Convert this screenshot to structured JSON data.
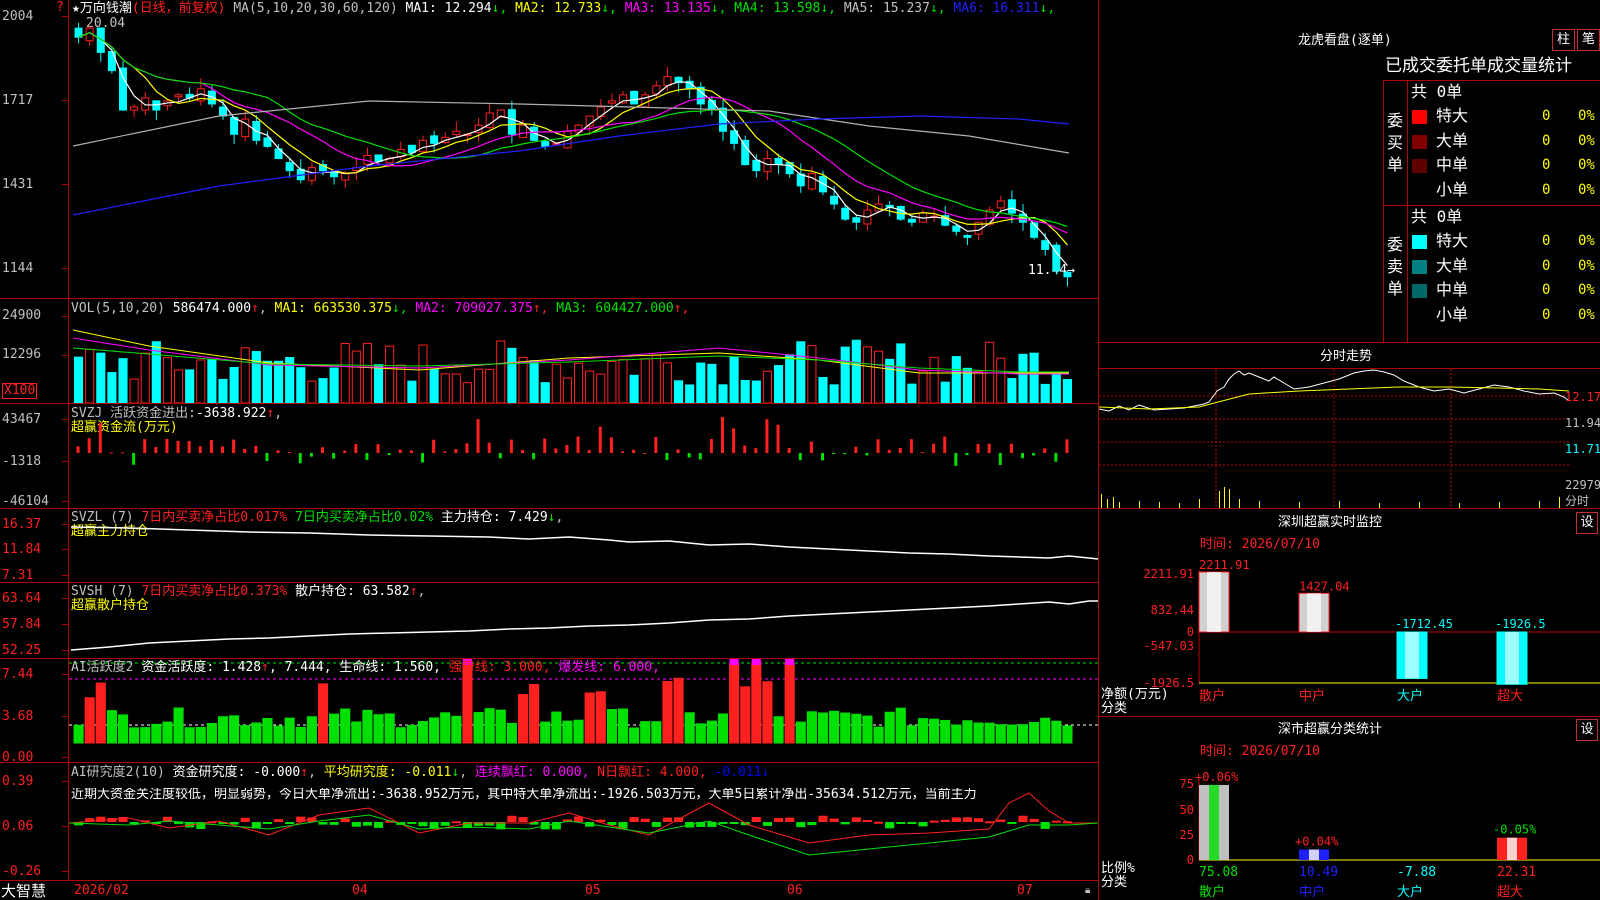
{
  "colors": {
    "up": "#ff2020",
    "down": "#00ffff",
    "red_line": "#c00000",
    "white": "#ffffff",
    "yellow": "#ffff00",
    "magenta": "#ff00ff",
    "green": "#00e000",
    "blue": "#2020ff",
    "grey": "#b0b0b0",
    "gray_text": "#c0c0c0"
  },
  "price_panel": {
    "title": "万向钱潮",
    "mode": "(日线，前复权)",
    "ma_prefix": "MA(5,10,20,30,60,120)",
    "ma": [
      {
        "label": "MA1:",
        "value": "12.294",
        "arrow": "↓",
        "color": "#ffffff"
      },
      {
        "label": "MA2:",
        "value": "12.733",
        "arrow": "↓",
        "color": "#ffff00"
      },
      {
        "label": "MA3:",
        "value": "13.135",
        "arrow": "↓",
        "color": "#ff00ff"
      },
      {
        "label": "MA4:",
        "value": "13.598",
        "arrow": "↓",
        "color": "#00e000"
      },
      {
        "label": "MA5:",
        "value": "15.237",
        "arrow": "↓",
        "color": "#c0c0c0"
      },
      {
        "label": "MA6:",
        "value": "16.311",
        "arrow": "↓",
        "color": "#2020ff"
      }
    ],
    "y_ticks": [
      "2004",
      "1717",
      "1431",
      "1144"
    ],
    "high_marker": "20.04",
    "low_marker": "11.44→",
    "question": "?"
  },
  "vol_panel": {
    "title": "VOL(5,10,20)",
    "value": "586474.000",
    "arrow": "↑",
    "ma": [
      {
        "label": "MA1:",
        "value": "663530.375",
        "arrow": "↓",
        "color": "#ffff00"
      },
      {
        "label": "MA2:",
        "value": "709027.375",
        "arrow": "↑",
        "color": "#ff00ff"
      },
      {
        "label": "MA3:",
        "value": "604427.000",
        "arrow": "↑",
        "color": "#00e000"
      }
    ],
    "y_ticks": [
      "24900",
      "12296"
    ],
    "unit": "X100"
  },
  "svzj_panel": {
    "title": "SVZJ",
    "desc": "活跃资金进出:",
    "value": "-3638.922",
    "arrow": "↑",
    "suffix": ",",
    "line2": "超赢资金流(万元)",
    "y_ticks": [
      "43467",
      "-1318",
      "-46104"
    ]
  },
  "svzl_panel": {
    "title": "SVZL (7)",
    "p1": "7日内买卖净占比0.017%",
    "p2": "7日内买卖净占比0.02%",
    "p3": "主力持仓: 7.429",
    "arrow": "↓",
    "suffix": ",",
    "line2": "超赢主力持仓",
    "y_ticks": [
      "16.37",
      "11.84",
      "7.31"
    ]
  },
  "svsh_panel": {
    "title": "SVSH (7)",
    "p1": "7日内买卖净占比0.373%",
    "p3": "散户持仓: 63.582",
    "arrow": "↑",
    "suffix": ",",
    "line2": "超赢散户持仓",
    "y_ticks": [
      "63.64",
      "57.84",
      "52.25"
    ]
  },
  "ai1_panel": {
    "title": "AI活跃度2",
    "t1": "资金活跃度: 1.428",
    "a1": "↑",
    "t2": ", 7.444,",
    "t3": "生命线: 1.560,",
    "t4": "强势线: 3.000,",
    "t5": "爆发线: 6.000,",
    "y_ticks": [
      "7.44",
      "3.68",
      "0.00"
    ]
  },
  "ai2_panel": {
    "title": "AI研究度2(10)",
    "t1": "资金研究度: -0.000",
    "a1": "↑",
    "t2": "平均研究度: -0.011",
    "a2": "↓",
    "t3": "连续飘红: 0.000,",
    "t4": "N日飘红: 4.000,",
    "t5": "-0.011",
    "a5": "↓",
    "y_ticks": [
      "0.39",
      "0.06",
      "-0.26"
    ],
    "commentary": "近期大资金关注度较低，明显弱势，今日大单净流出:-3638.952万元，其中特大单净流出:-1926.503万元，大单5日累计净出-35634.512万元，当前主力"
  },
  "x_axis": {
    "logo": "大智慧",
    "labels": [
      "2026/02",
      "04",
      "05",
      "06",
      "07"
    ]
  },
  "right": {
    "lhb_title": "龙虎看盘(逐单)",
    "btn_bar": "柱",
    "btn_pen": "笔",
    "tabs": [
      "已成交",
      "委托单",
      "成交量",
      "统计"
    ],
    "buy": {
      "side": [
        "委",
        "买",
        "单"
      ],
      "count": "共 0单",
      "rows": [
        {
          "name": "特大",
          "color": "#ff0000",
          "count": "0",
          "pct": "0%"
        },
        {
          "name": "大单",
          "color": "#800000",
          "count": "0",
          "pct": "0%"
        },
        {
          "name": "中单",
          "color": "#600000",
          "count": "0",
          "pct": "0%"
        },
        {
          "name": "小单",
          "color": "",
          "count": "0",
          "pct": "0%"
        }
      ]
    },
    "sell": {
      "side": [
        "委",
        "卖",
        "单"
      ],
      "count": "共 0单",
      "rows": [
        {
          "name": "特大",
          "color": "#00ffff",
          "count": "0",
          "pct": "0%"
        },
        {
          "name": "大单",
          "color": "#008080",
          "count": "0",
          "pct": "0%"
        },
        {
          "name": "中单",
          "color": "#006868",
          "count": "0",
          "pct": "0%"
        },
        {
          "name": "小单",
          "color": "",
          "count": "0",
          "pct": "0%"
        }
      ]
    },
    "intraday_title": "分时走势",
    "intraday_ticks": [
      "12.17",
      "11.94",
      "11.71",
      "22979",
      "分时"
    ],
    "sz_title": "深圳超赢实时监控",
    "sz_btn": "设",
    "sz_time": "时间: 2026/07/10",
    "sz_yticks": [
      "2211.91",
      "832.44",
      "0",
      "-547.03",
      "-1926.5"
    ],
    "sz_bars": [
      {
        "cat": "散户",
        "value": 2211.91,
        "label": "2211.91"
      },
      {
        "cat": "中户",
        "value": 1427.04,
        "label": "1427.04"
      },
      {
        "cat": "大户",
        "value": -1712.45,
        "label": "-1712.45"
      },
      {
        "cat": "超大",
        "value": -1926.5,
        "label": "-1926.5"
      }
    ],
    "sz_ylabel": "净额(万元)",
    "sz_xlabel": "分类",
    "sc_title": "深市超赢分类统计",
    "sc_btn": "设",
    "sc_time": "时间: 2026/07/10",
    "sc_yticks": [
      "75",
      "50",
      "25",
      "0"
    ],
    "sc_bars": [
      {
        "cat": "散户",
        "value": 75.08,
        "label": "75.08",
        "delta": "+0.06%"
      },
      {
        "cat": "中户",
        "value": 10.49,
        "label": "10.49",
        "delta": "+0.04%"
      },
      {
        "cat": "大户",
        "value": -7.88,
        "label": "-7.88",
        "delta": ""
      },
      {
        "cat": "超大",
        "value": 22.31,
        "label": "22.31",
        "delta": "-0.05%"
      }
    ],
    "sc_ylabel": "比例%",
    "sc_xlabel": "分类"
  },
  "chart_data": [
    {
      "type": "candlestick",
      "title": "万向钱潮",
      "ylim": [
        11.44,
        20.04
      ],
      "x_labels": [
        "2026/02",
        "04",
        "05",
        "06",
        "07"
      ],
      "series": [
        {
          "name": "MA1",
          "last": 12.294
        },
        {
          "name": "MA2",
          "last": 12.733
        },
        {
          "name": "MA3",
          "last": 13.135
        },
        {
          "name": "MA4",
          "last": 13.598
        },
        {
          "name": "MA5",
          "last": 15.237
        },
        {
          "name": "MA6",
          "last": 16.311
        }
      ],
      "close": [
        19.6,
        19.9,
        19.1,
        18.5,
        17.2,
        17.3,
        17.6,
        17.2,
        17.5,
        17.7,
        17.6,
        17.9,
        17.4,
        17.0,
        16.4,
        16.9,
        16.2,
        16.0,
        15.6,
        15.2,
        14.9,
        15.3,
        15.2,
        15.0,
        15.1,
        15.3,
        15.7,
        15.5,
        15.6,
        15.9,
        15.8,
        16.2,
        16.1,
        16.3,
        16.5,
        16.4,
        16.7,
        17.1,
        17.2,
        16.4,
        16.7,
        16.2,
        16.0,
        16.1,
        16.5,
        16.7,
        17.0,
        17.3,
        17.5,
        17.7,
        17.4,
        17.7,
        18.0,
        18.3,
        18.1,
        17.9,
        17.4,
        17.2,
        16.5,
        16.1,
        15.4,
        15.2,
        15.6,
        15.4,
        15.1,
        14.7,
        15.1,
        14.5,
        14.1,
        13.6,
        13.5,
        13.9,
        14.1,
        14.0,
        13.6,
        13.5,
        13.8,
        13.7,
        13.4,
        13.2,
        13.0,
        13.5,
        13.9,
        14.2,
        13.8,
        13.5,
        13.0,
        12.6,
        11.9,
        11.7
      ]
    }
  ]
}
